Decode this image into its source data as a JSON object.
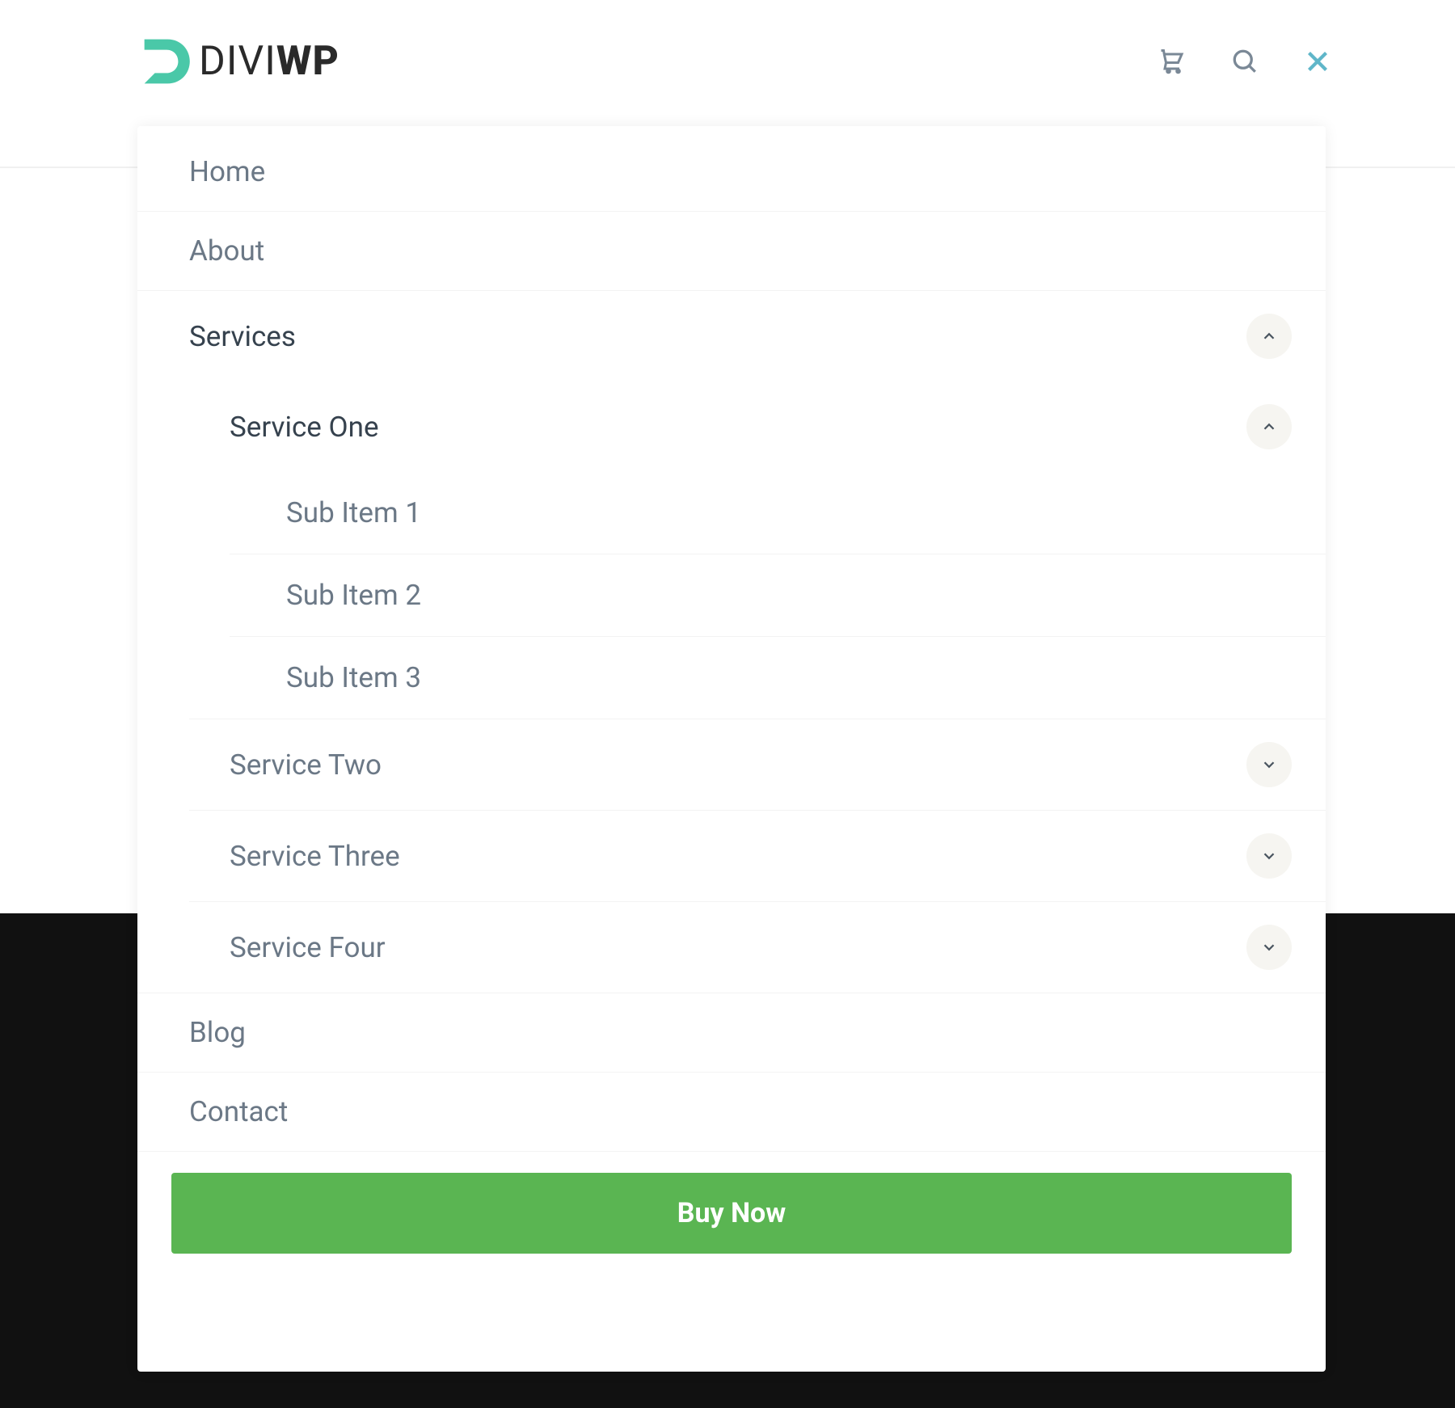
{
  "logo": {
    "part1": "DIVI",
    "part2": "WP"
  },
  "menu": {
    "home": "Home",
    "about": "About",
    "services": {
      "label": "Services",
      "service_one": {
        "label": "Service One",
        "sub1": "Sub Item 1",
        "sub2": "Sub Item 2",
        "sub3": "Sub Item 3"
      },
      "service_two": "Service Two",
      "service_three": "Service Three",
      "service_four": "Service Four"
    },
    "blog": "Blog",
    "contact": "Contact"
  },
  "cta": {
    "buy_now": "Buy Now"
  }
}
